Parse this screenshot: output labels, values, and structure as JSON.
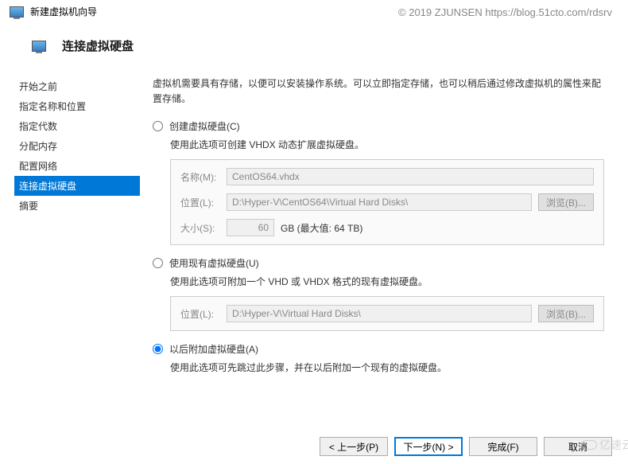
{
  "watermark": "© 2019 ZJUNSEN https://blog.51cto.com/rdsrv",
  "window_title": "新建虚拟机向导",
  "header_title": "连接虚拟硬盘",
  "sidebar": {
    "items": [
      {
        "label": "开始之前"
      },
      {
        "label": "指定名称和位置"
      },
      {
        "label": "指定代数"
      },
      {
        "label": "分配内存"
      },
      {
        "label": "配置网络"
      },
      {
        "label": "连接虚拟硬盘"
      },
      {
        "label": "摘要"
      }
    ]
  },
  "intro": "虚拟机需要具有存储，以便可以安装操作系统。可以立即指定存储，也可以稍后通过修改虚拟机的属性来配置存储。",
  "option1": {
    "label": "创建虚拟硬盘(C)",
    "desc": "使用此选项可创建 VHDX 动态扩展虚拟硬盘。",
    "name_label": "名称(M):",
    "name_value": "CentOS64.vhdx",
    "loc_label": "位置(L):",
    "loc_value": "D:\\Hyper-V\\CentOS64\\Virtual Hard Disks\\",
    "browse": "浏览(B)...",
    "size_label": "大小(S):",
    "size_value": "60",
    "size_suffix": "GB (最大值: 64 TB)"
  },
  "option2": {
    "label": "使用现有虚拟硬盘(U)",
    "desc": "使用此选项可附加一个 VHD 或 VHDX 格式的现有虚拟硬盘。",
    "loc_label": "位置(L):",
    "loc_value": "D:\\Hyper-V\\Virtual Hard Disks\\",
    "browse": "浏览(B)..."
  },
  "option3": {
    "label": "以后附加虚拟硬盘(A)",
    "desc": "使用此选项可先跳过此步骤，并在以后附加一个现有的虚拟硬盘。"
  },
  "footer": {
    "back": "< 上一步(P)",
    "next": "下一步(N) >",
    "finish": "完成(F)",
    "cancel": "取消"
  },
  "corner_brand": "亿速云"
}
